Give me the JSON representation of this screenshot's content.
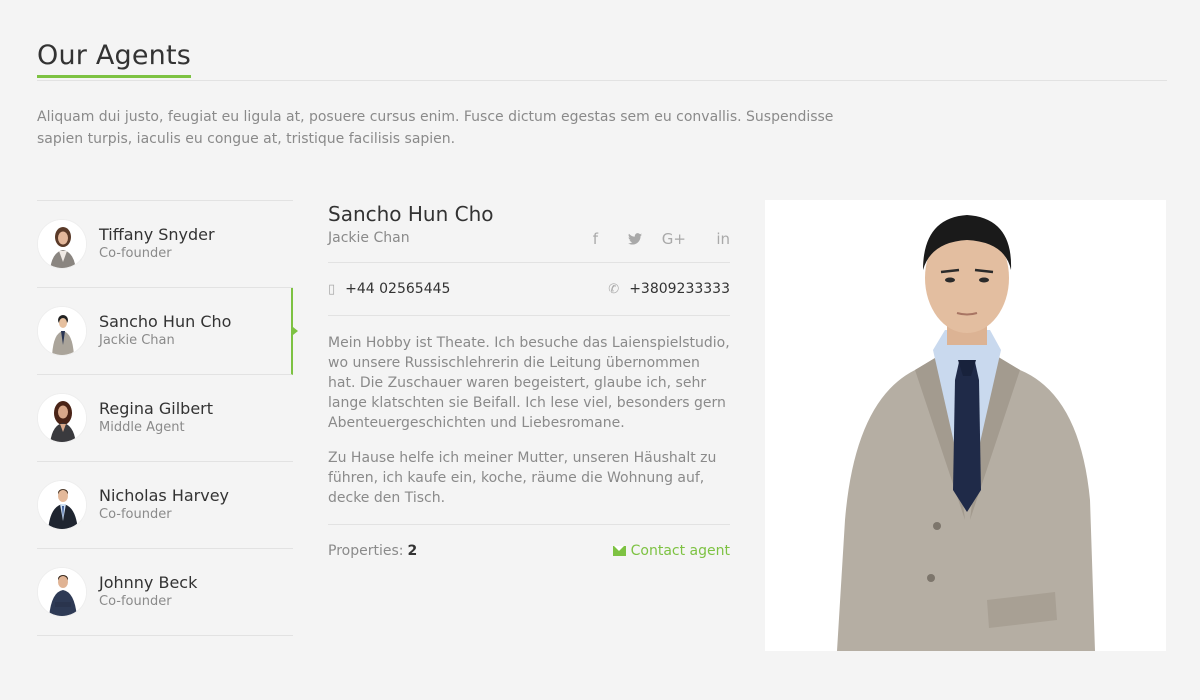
{
  "header": {
    "title": "Our Agents",
    "intro": "Aliquam dui justo, feugiat eu ligula at, posuere cursus enim. Fusce dictum egestas sem eu convallis. Suspendisse sapien turpis, iaculis eu congue at, tristique facilisis sapien."
  },
  "agents": [
    {
      "name": "Tiffany Snyder",
      "role": "Co-founder"
    },
    {
      "name": "Sancho Hun Cho",
      "role": "Jackie Chan"
    },
    {
      "name": "Regina Gilbert",
      "role": "Middle Agent"
    },
    {
      "name": "Nicholas Harvey",
      "role": "Co-founder"
    },
    {
      "name": "Johnny Beck",
      "role": "Co-founder"
    }
  ],
  "selected": {
    "name": "Sancho Hun Cho",
    "subtitle": "Jackie Chan",
    "mobile": "+44 02565445",
    "phone": "+3809233333",
    "bio_1": "Mein Hobby ist Theate. Ich besuche das Laienspielstudio, wo unsere Russischlehrerin die Leitung übernommen hat. Die Zuschauer waren begeistert, glaube ich, sehr lange klatschten sie Beifall. Ich lese viel, besonders gern Abenteuergeschichten und Liebesromane.",
    "bio_2": "Zu Hause helfe ich meiner Mutter, unseren Häushalt zu führen, ich kaufe ein, koche, räume die Wohnung auf, decke den Tisch.",
    "properties_label": "Properties:",
    "properties_count": "2",
    "contact_label": "Contact agent"
  },
  "social": {
    "facebook": "f",
    "twitter": "🐦",
    "googleplus": "G+",
    "linkedin": "in"
  },
  "icons": {
    "mobile": "▯",
    "phone": "✆"
  },
  "colors": {
    "accent": "#7dc242",
    "background": "#f4f4f4"
  }
}
